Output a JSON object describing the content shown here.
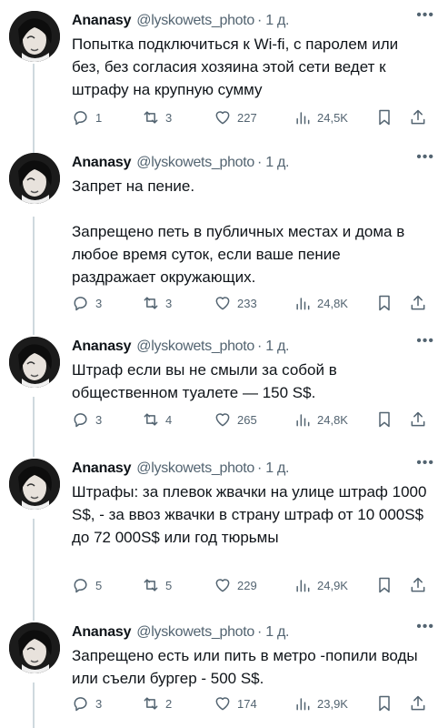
{
  "tweets": [
    {
      "author_name": "Ananasy",
      "author_handle": "@lyskowets_photo",
      "time": "· 1 д.",
      "text": "Попытка подключиться к Wi-fi, с паролем или без, без согласия хозяина этой сети ведет к штрафу на крупную сумму",
      "replies": "1",
      "retweets": "3",
      "likes": "227",
      "views": "24,5K"
    },
    {
      "author_name": "Ananasy",
      "author_handle": "@lyskowets_photo",
      "time": "· 1 д.",
      "text": "Запрет на пение.\n\nЗапрещено петь в публичных местах и дома в любое время суток, если ваше пение раздражает окружающих.",
      "replies": "3",
      "retweets": "3",
      "likes": "233",
      "views": "24,8K"
    },
    {
      "author_name": "Ananasy",
      "author_handle": "@lyskowets_photo",
      "time": "· 1 д.",
      "text": "Штраф если вы не смыли за собой в общественном туалете — 150 S$.",
      "replies": "3",
      "retweets": "4",
      "likes": "265",
      "views": "24,8K"
    },
    {
      "author_name": "Ananasy",
      "author_handle": "@lyskowets_photo",
      "time": "· 1 д.",
      "text": "Штрафы: за плевок жвачки на улице штраф 1000 S$, - за ввоз жвачки в страну штраф от 10 000S$ до 72 000S$ или год тюрьмы",
      "replies": "5",
      "retweets": "5",
      "likes": "229",
      "views": "24,9K"
    },
    {
      "author_name": "Ananasy",
      "author_handle": "@lyskowets_photo",
      "time": "· 1 д.",
      "text": "Запрещено есть или пить в метро -попили воды или съели бургер - 500 S$.",
      "replies": "3",
      "retweets": "2",
      "likes": "174",
      "views": "23,9K"
    }
  ],
  "icons": {
    "more": "more-dots-icon",
    "reply": "speech-bubble-icon",
    "retweet": "retweet-arrows-icon",
    "like": "heart-icon",
    "views": "bar-chart-icon",
    "bookmark": "bookmark-icon",
    "share": "share-upload-icon"
  },
  "colors": {
    "text": "#0f1419",
    "secondary": "#536471",
    "thread_line": "#cfd9de"
  }
}
